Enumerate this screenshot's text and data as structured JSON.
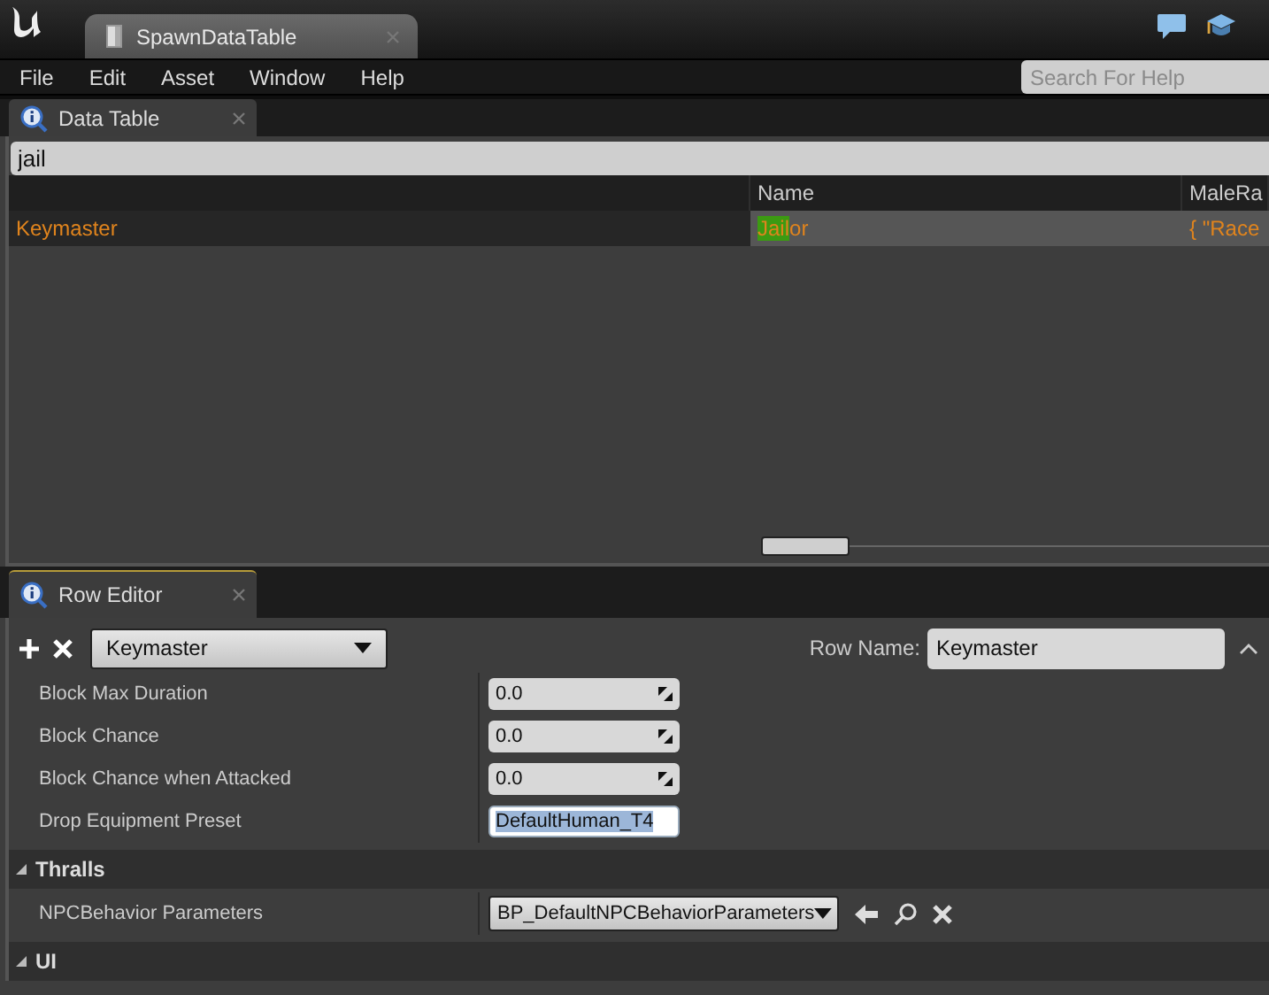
{
  "window": {
    "document_tab": {
      "title": "SpawnDataTable",
      "selected": true
    }
  },
  "menu": [
    "File",
    "Edit",
    "Asset",
    "Window",
    "Help"
  ],
  "help_search": {
    "placeholder": "Search For Help"
  },
  "data_table_panel": {
    "tab": {
      "title": "Data Table",
      "selected": true
    },
    "filter": {
      "value": "jail"
    },
    "columns": [
      "",
      "Name",
      "MaleRa"
    ],
    "rows": [
      {
        "row_name": "Keymaster",
        "name": {
          "match": "Jail",
          "rest": "or"
        },
        "column_3": "{ \"Race"
      }
    ]
  },
  "row_editor_panel": {
    "tab": {
      "title": "Row Editor",
      "selected": true
    },
    "row_select": {
      "value": "Keymaster"
    },
    "row_name": {
      "label": "Row Name:",
      "value": "Keymaster"
    },
    "sections": [
      {
        "rows": [
          {
            "kind": "number",
            "label": "Block Max Duration",
            "value": "0.0"
          },
          {
            "kind": "number",
            "label": "Block Chance",
            "value": "0.0"
          },
          {
            "kind": "number",
            "label": "Block Chance when Attacked",
            "value": "0.0"
          },
          {
            "kind": "text",
            "label": "Drop Equipment Preset",
            "value": "DefaultHuman_T4",
            "text_selected": true
          }
        ]
      },
      {
        "title": "Thralls",
        "expanded": true,
        "rows": [
          {
            "kind": "asset",
            "label": "NPCBehavior Parameters",
            "value": "BP_DefaultNPCBehaviorParameters"
          }
        ]
      },
      {
        "title": "UI",
        "expanded": true
      }
    ]
  }
}
